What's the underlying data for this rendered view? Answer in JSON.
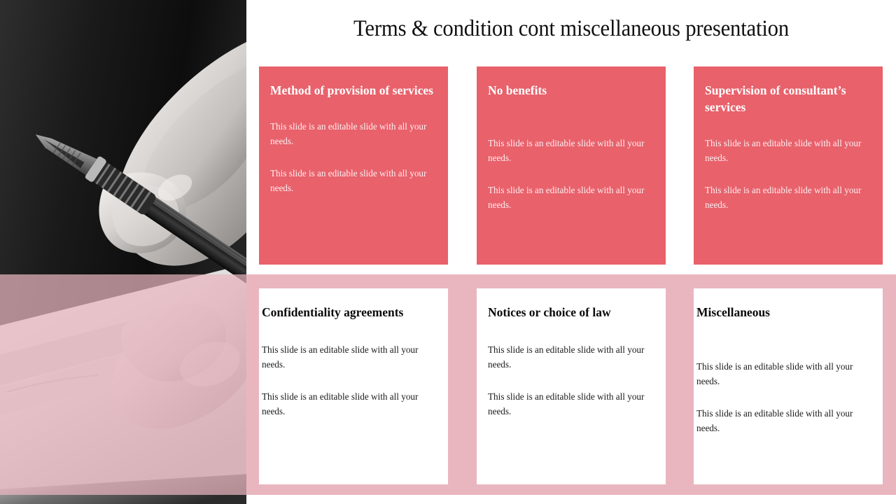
{
  "slide": {
    "title": "Terms & condition cont miscellaneous presentation",
    "colors": {
      "accent_red": "#E8616B",
      "band_pink": "#E9B6BF",
      "card_white": "#FFFFFF",
      "title_text": "#101010"
    }
  },
  "photo": {
    "alt": "hand-holding-fountain-pen-writing-on-paper"
  },
  "cards": {
    "top_row": [
      {
        "heading": "Method of provision of services",
        "paragraphs": [
          "This slide is an editable slide with all your needs.",
          "This slide is an editable slide with all your needs."
        ]
      },
      {
        "heading": "No benefits",
        "paragraphs": [
          "This slide is an editable slide with all your needs.",
          "This slide is an editable slide with all your needs."
        ]
      },
      {
        "heading": "Supervision of consultant’s services",
        "paragraphs": [
          "This slide is an editable slide with all your needs.",
          "This slide is an editable slide with all your needs."
        ]
      }
    ],
    "bottom_row": [
      {
        "heading": "Confidentiality agreements",
        "paragraphs": [
          "This slide is an editable slide with all your needs.",
          "This slide is an editable slide with all your needs."
        ]
      },
      {
        "heading": "Notices or choice of law",
        "paragraphs": [
          "This slide is an editable slide with all your needs.",
          "This slide is an editable slide with all your needs."
        ]
      },
      {
        "heading": "Miscellaneous",
        "paragraphs": [
          "This slide is an editable slide with all your needs.",
          "This slide is an editable slide with all your needs."
        ]
      }
    ]
  }
}
